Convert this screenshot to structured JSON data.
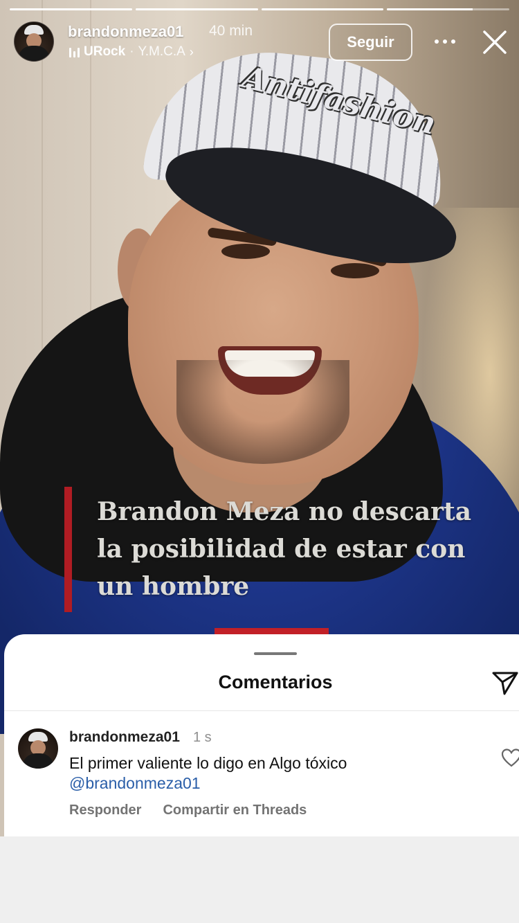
{
  "progress": [
    1,
    1,
    1,
    0.7
  ],
  "header": {
    "username": "brandonmeza01",
    "time": "40 min",
    "music": {
      "artist": "URock",
      "separator": "·",
      "song": "Y.M.C.A",
      "chevron": "›"
    },
    "follow_label": "Seguir",
    "more_icon": "more-horizontal-icon",
    "close_icon": "close-icon"
  },
  "story": {
    "cap_text": "Antifashion",
    "caption": "Brandon Meza no descarta\nla posibilidad de estar con\nun hombre",
    "accent_color": "#b01c23"
  },
  "comments": {
    "title": "Comentarios",
    "share_icon": "send-icon",
    "items": [
      {
        "username": "brandonmeza01",
        "time": "1 s",
        "text": "El primer valiente lo digo en Algo tóxico",
        "mention": "@brandonmeza01",
        "reply_label": "Responder",
        "share_label": "Compartir en Threads",
        "like_icon": "heart-icon"
      }
    ]
  }
}
